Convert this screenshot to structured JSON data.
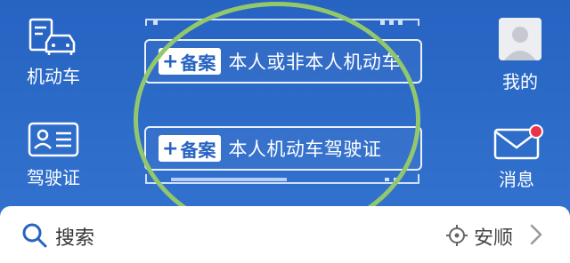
{
  "nav_left": [
    {
      "label": "机动车",
      "icon": "car-registration-icon"
    },
    {
      "label": "驾驶证",
      "icon": "driver-license-icon"
    }
  ],
  "nav_right": [
    {
      "label": "我的",
      "icon": "user-avatar-icon"
    },
    {
      "label": "消息",
      "icon": "mail-icon",
      "has_unread_badge": true
    }
  ],
  "cards": [
    {
      "badge_plus": "+",
      "badge": "备案",
      "text": "本人或非本人机动车"
    },
    {
      "badge_plus": "+",
      "badge": "备案",
      "text": "本人机动车驾驶证"
    }
  ],
  "search": {
    "label": "搜索",
    "icon": "search-icon"
  },
  "location": {
    "city": "安顺",
    "icon": "crosshair-location-icon"
  },
  "colors": {
    "header_blue": "#2763c2",
    "ring_green": "#92c86b",
    "badge_red": "#e8334a"
  }
}
